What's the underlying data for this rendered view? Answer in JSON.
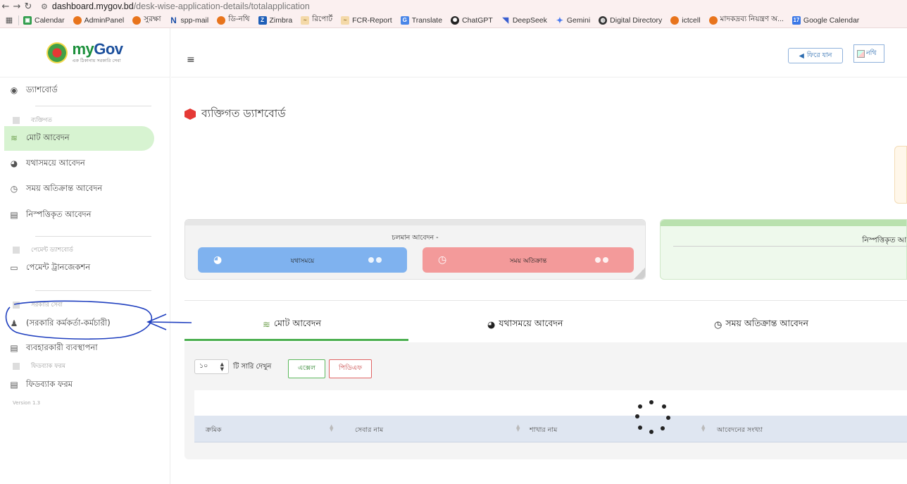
{
  "browser": {
    "url_host": "dashboard.mygov.bd",
    "url_path": "/desk-wise-application-details/totalapplication",
    "bookmarks": [
      "Calendar",
      "AdminPanel",
      "সুরক্ষা",
      "spp-mail",
      "ডি-নথি",
      "Zimbra",
      "রিপোর্ট",
      "FCR-Report",
      "Translate",
      "ChatGPT",
      "DeepSeek",
      "Gemini",
      "Digital Directory",
      "ictcell",
      "মাদকদ্রব্য নিয়ন্ত্রণ অ...",
      "Google Calendar"
    ]
  },
  "logo": {
    "my": "my",
    "gov": "Gov",
    "tagline": "এক ঠিকানায় সরকারি সেবা"
  },
  "sidebar": {
    "dashboard": "ড্যাশবোর্ড",
    "section_personal": "ব্যক্তিগত",
    "total_applications": "মোট আবেদন",
    "timely_applications": "যথাসময়ে আবেদন",
    "overdue_applications": "সময় অতিক্রান্ত আবেদন",
    "disposed_applications": "নিস্পত্তিকৃত আবেদন",
    "section_payment": "পেমেন্ট ড্যাশবোর্ড",
    "payment_transactions": "পেমেন্ট ট্রানজেকশন",
    "section_gov_service": "সরকারি সেবা",
    "gov_officials": "(সরকারি কর্মকর্তা-কর্মচারী)",
    "user_management": "ব্যবহারকারী ব্যবস্থাপনা",
    "section_feedback": "ফিডব্যাক ফরম",
    "feedback_form": "ফিডব্যাক ফরম",
    "version": "Version 1.3"
  },
  "topbar": {
    "back_button": "ফিরে যান",
    "nothi_button": "নথি"
  },
  "main": {
    "page_title": "ব্যক্তিগত ড্যাশবোর্ড",
    "ongoing_title": "চলমান আবেদন -",
    "timely_label": "যথাসময়ে",
    "overdue_label": "সময় অতিক্রান্ত",
    "disposed_title": "নিস্পত্তিকৃত আ"
  },
  "tabs": {
    "total": "মোট আবেদন",
    "timely": "যথাসময়ে আবেদন",
    "overdue": "সময় অতিক্রান্ত আবেদন"
  },
  "table": {
    "page_length": "১০",
    "length_label": "টি সারি দেখুন",
    "excel": "এক্সেল",
    "pdf": "পিডিএফ",
    "columns": [
      "ক্রমিক",
      "সেবার নাম",
      "শাখার নাম",
      "আবেদনের সংখ্যা"
    ]
  },
  "colors": {
    "accent_green": "#4caf50",
    "timely_blue": "#7fb2ef",
    "overdue_red": "#f39a9a",
    "annotation_blue": "#1f3fbf"
  }
}
